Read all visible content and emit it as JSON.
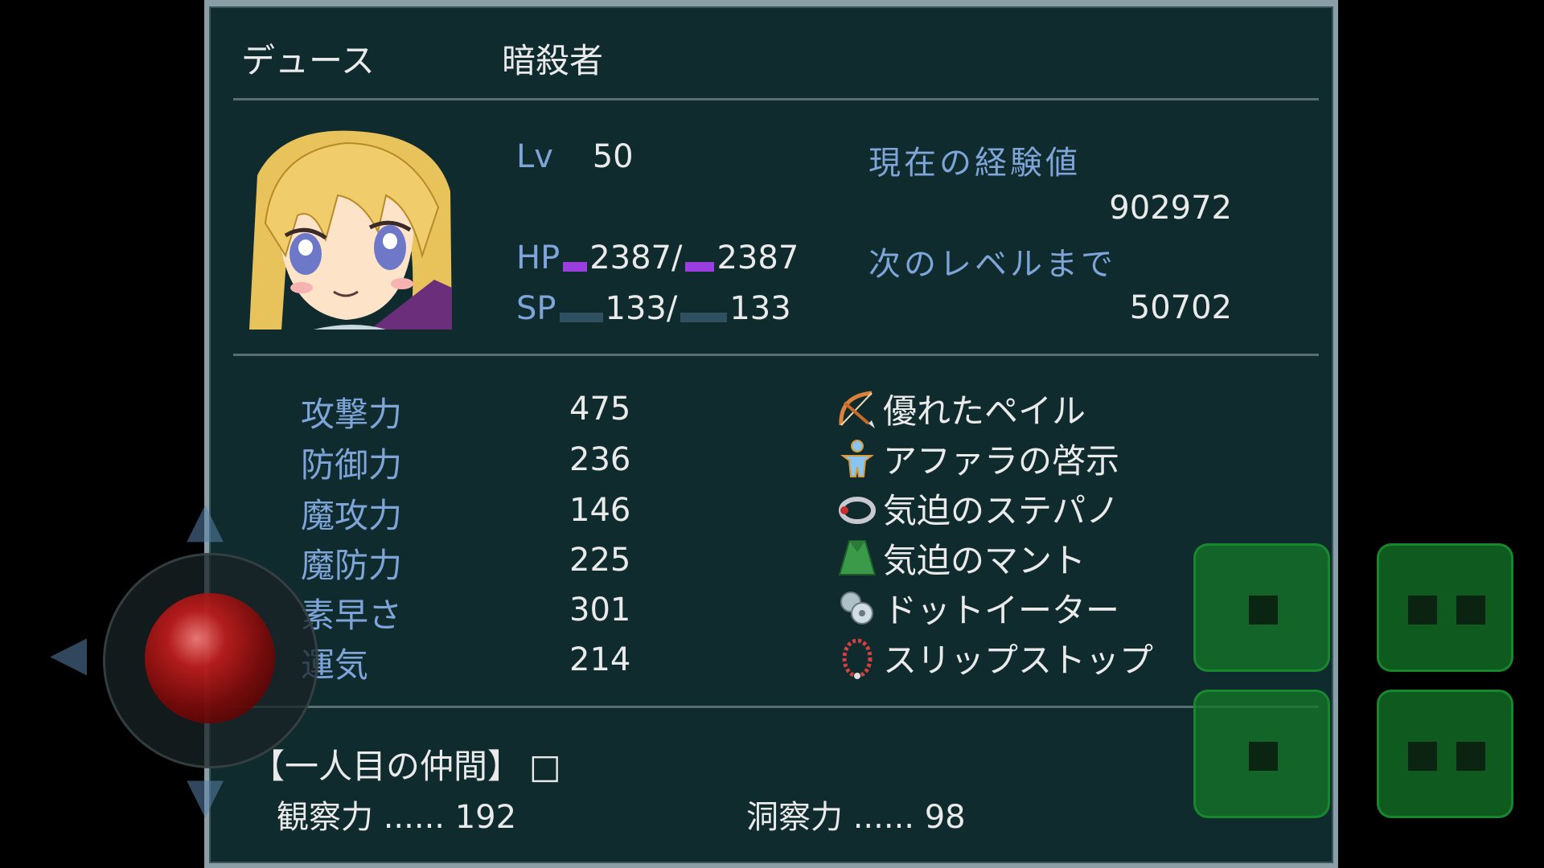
{
  "character": {
    "name": "デュース",
    "class": "暗殺者",
    "level_label": "Lv",
    "level": "50",
    "hp_label": "HP",
    "hp_current": "2387",
    "hp_max": "2387",
    "sp_label": "SP",
    "sp_current": "133",
    "sp_max": "133",
    "hp_fraction": 1.0,
    "sp_fraction": 1.0,
    "slash": "/"
  },
  "experience": {
    "current_label": "現在の経験値",
    "current_value": "902972",
    "next_label": "次のレベルまで",
    "next_value": "50702"
  },
  "stats": [
    {
      "label": "攻撃力",
      "value": "475"
    },
    {
      "label": "防御力",
      "value": "236"
    },
    {
      "label": "魔攻力",
      "value": "146"
    },
    {
      "label": "魔防力",
      "value": "225"
    },
    {
      "label": "素早さ",
      "value": "301"
    },
    {
      "label": "運気",
      "value": "214"
    }
  ],
  "equipment": [
    {
      "name": "優れたペイル",
      "icon": "bow-icon"
    },
    {
      "name": "アファラの啓示",
      "icon": "figure-icon"
    },
    {
      "name": "気迫のステパノ",
      "icon": "ring-icon"
    },
    {
      "name": "気迫のマント",
      "icon": "cloak-icon"
    },
    {
      "name": "ドットイーター",
      "icon": "gear-accessory-icon"
    },
    {
      "name": "スリップストップ",
      "icon": "necklace-icon"
    }
  ],
  "companion": {
    "heading": "【一人目の仲間】",
    "checkbox": "□",
    "observation": "観察力 ...... 192",
    "insight": "洞察力 ...... 98"
  },
  "colors": {
    "panel_bg": "#0f2b2e",
    "label_blue": "#7ea4d8",
    "hp_bar": "#9a3ee0",
    "sp_bar": "#2f5060",
    "pad_green": "#1c8a32"
  }
}
